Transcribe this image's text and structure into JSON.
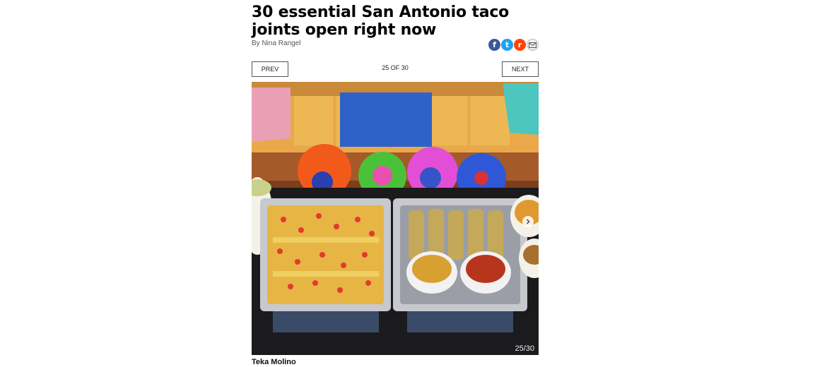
{
  "article": {
    "title": "30 essential San Antonio taco joints open right now",
    "byline": "By Nina Rangel"
  },
  "share": {
    "facebook_glyph": "f",
    "twitter_glyph": "t",
    "reddit_glyph": "r",
    "mail_glyph": "✉",
    "icons": [
      "facebook-icon",
      "twitter-icon",
      "reddit-icon",
      "mail-icon"
    ]
  },
  "gallery": {
    "prev_label": "PREV",
    "next_label": "NEXT",
    "counter": "25 OF 30",
    "photo_count": "25/30",
    "caption": "Teka Molino"
  },
  "colors": {
    "facebook": "#3b5998",
    "twitter": "#1da1f2",
    "reddit": "#ff4500"
  }
}
